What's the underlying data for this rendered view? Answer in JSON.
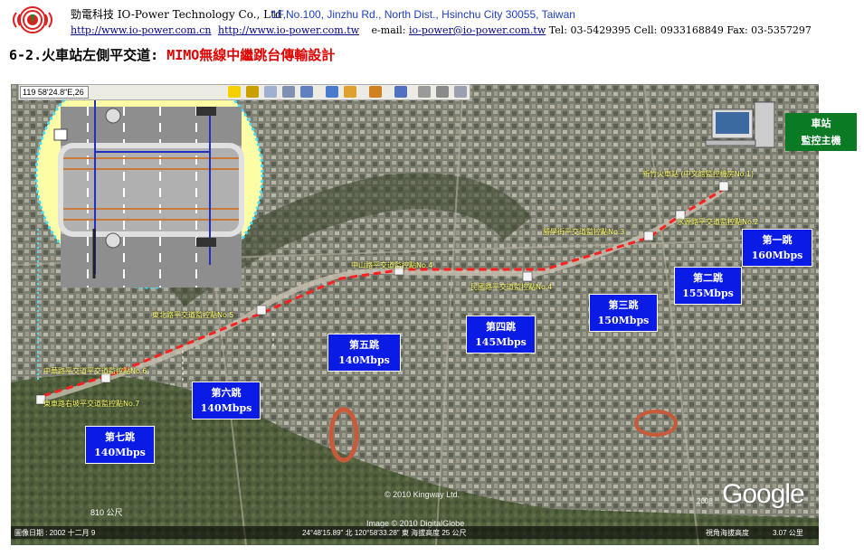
{
  "header": {
    "company": "勁電科技 IO-Power Technology Co., Ltd",
    "address": "1F,No.100, Jinzhu Rd., North Dist., Hsinchu City 30055, Taiwan",
    "link1": "http://www.io-power.com.cn",
    "link2": "http://www.io-power.com.tw",
    "email_label": "e-mail:",
    "email": "io-power@io-power.com.tw",
    "phones": "Tel: 03-5429395 Cell: 0933168849 Fax: 03-5357297"
  },
  "title": {
    "prefix": "6-2.火車站左側平交道: ",
    "highlight": "MIMO無線中繼跳台傳輸設計"
  },
  "toolbar": {
    "coord": "119 58'24.8\"E,26"
  },
  "station": {
    "line1": "車站",
    "line2": "監控主機"
  },
  "hops": [
    {
      "name": "第一跳",
      "rate": "160Mbps"
    },
    {
      "name": "第二跳",
      "rate": "155Mbps"
    },
    {
      "name": "第三跳",
      "rate": "150Mbps"
    },
    {
      "name": "第四跳",
      "rate": "145Mbps"
    },
    {
      "name": "第五跳",
      "rate": "140Mbps"
    },
    {
      "name": "第六跳",
      "rate": "140Mbps"
    },
    {
      "name": "第七跳",
      "rate": "140Mbps"
    }
  ],
  "nodes": {
    "station": "新竹火車站 (中文館監控機房No.1)",
    "n2": "水源路平交道監控點No.2",
    "n3": "勝學街平交道監控點No.3",
    "n4": "民國路平交道監控點No.4",
    "n5": "中山路平交道監控點No.4",
    "n6": "東北路平交道監控點No.5",
    "n7": "中華路平交道平交道監控點No.6",
    "n8": "東車路右坡平交道監控點No.7"
  },
  "status": {
    "date": "圖像日期 : 2002 十二月 9",
    "coords": "24°48'15.89\" 北    120°58'33.28\" 東    海拔高度   25 公尺",
    "view": "視角海拔高度",
    "alt": "3.07 公里"
  },
  "map": {
    "copyright1": "© 2010 Kingway Ltd.",
    "copyright2": "Image © 2010 DigitalGlobe",
    "google": "Google",
    "year": "2008",
    "scale": "810 公尺"
  },
  "colors": {
    "title_red": "#e00000",
    "hop_blue": "#0b1be6",
    "station_green": "#0a7a25",
    "route_red": "#ff2020",
    "link_cyan": "#40e0ff"
  }
}
